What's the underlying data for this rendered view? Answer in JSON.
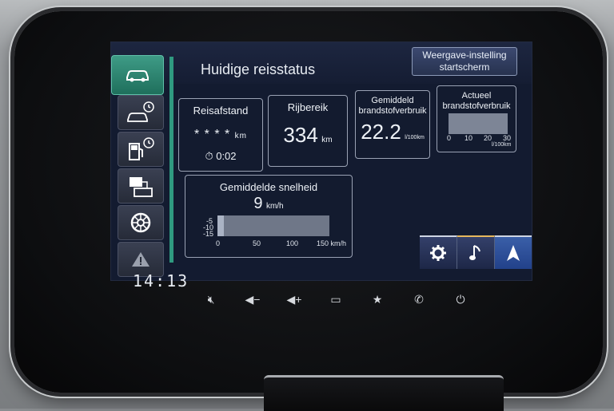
{
  "screen": {
    "title": "Huidige reisstatus",
    "header_button": {
      "line1": "Weergave-instelling",
      "line2": "startscherm"
    }
  },
  "side_tabs": [
    {
      "name": "car-icon",
      "active": true
    },
    {
      "name": "car-clock-icon",
      "active": false
    },
    {
      "name": "fuel-clock-icon",
      "active": false
    },
    {
      "name": "engine-diagnostics-icon",
      "active": false
    },
    {
      "name": "tire-icon",
      "active": false
    },
    {
      "name": "warning-icon",
      "active": false
    }
  ],
  "cards": {
    "reisafstand": {
      "title": "Reisafstand",
      "value": "* * * *",
      "unit": "km",
      "time": "0:02"
    },
    "rijbereik": {
      "title": "Rijbereik",
      "value": "334",
      "unit": "km"
    },
    "gemiddeld_verbruik": {
      "title_line1": "Gemiddeld",
      "title_line2": "brandstofverbruik",
      "value": "22.2",
      "unit": "l/100km"
    },
    "actueel_verbruik": {
      "title_line1": "Actueel",
      "title_line2": "brandstofverbruik",
      "ticks": [
        "0",
        "10",
        "20",
        "30"
      ],
      "unit": "l/100km",
      "level": 0
    },
    "gemiddelde_snelheid": {
      "title": "Gemiddelde snelheid",
      "value": "9",
      "unit": "km/h",
      "y_ticks": [
        "-5",
        "-10",
        "-15"
      ],
      "x_ticks": [
        "0",
        "50",
        "100",
        "150 km/h"
      ],
      "level_fraction": 0.06
    }
  },
  "bottom_bar": [
    {
      "name": "settings-gear-icon"
    },
    {
      "name": "music-note-icon"
    },
    {
      "name": "navigation-arrow-icon"
    }
  ],
  "clock": "14:13",
  "hardware_buttons": [
    {
      "name": "mute-icon"
    },
    {
      "name": "volume-down-icon"
    },
    {
      "name": "volume-up-icon"
    },
    {
      "name": "screen-icon"
    },
    {
      "name": "favorite-star-icon"
    },
    {
      "name": "phone-icon"
    },
    {
      "name": "power-icon"
    }
  ],
  "colors": {
    "accent_green": "#2f9a80",
    "screen_bg": "#131b30",
    "card_border": "#9aa2b4"
  }
}
